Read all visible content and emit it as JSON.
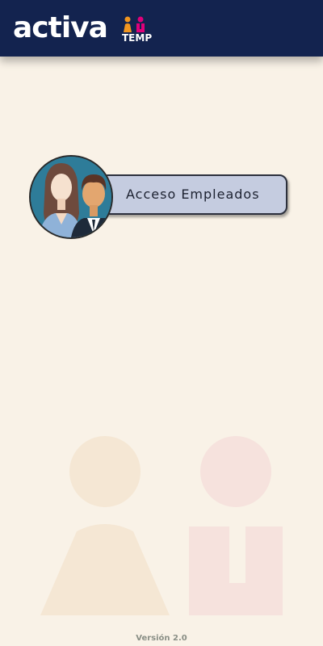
{
  "header": {
    "logo": {
      "word": "activa",
      "sub": "TEMP"
    }
  },
  "access": {
    "employees_label": "Acceso Empleados"
  },
  "footer": {
    "version": "Versión 2.0"
  },
  "colors": {
    "header_bg": "#13234f",
    "page_bg": "#f9f2e7",
    "button_bg": "#c5cce0",
    "logo_orange": "#f2961f",
    "logo_pink": "#e0007a"
  }
}
